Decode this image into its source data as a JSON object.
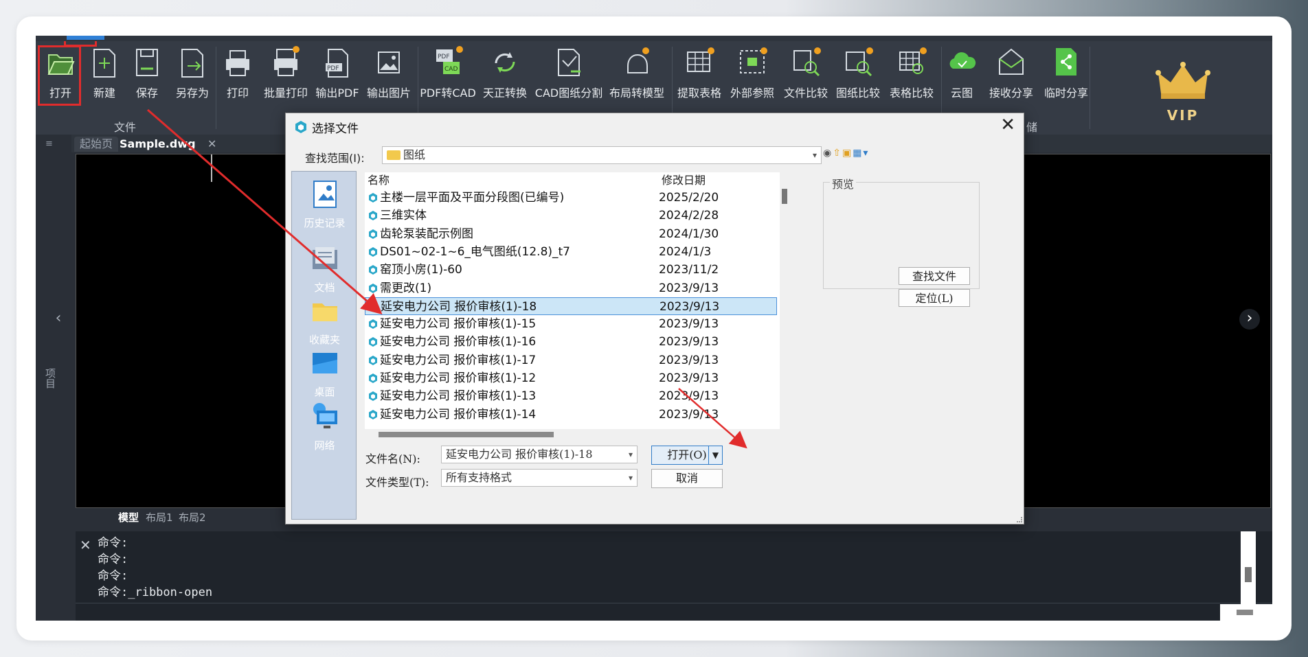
{
  "ribbon": {
    "buttons": [
      {
        "label": "打开"
      },
      {
        "label": "新建"
      },
      {
        "label": "保存"
      },
      {
        "label": "另存为"
      },
      {
        "label": "打印"
      },
      {
        "label": "批量打印"
      },
      {
        "label": "输出PDF"
      },
      {
        "label": "输出图片"
      },
      {
        "label": "PDF转CAD"
      },
      {
        "label": "天正转换"
      },
      {
        "label": "CAD图纸分割"
      },
      {
        "label": "布局转模型"
      },
      {
        "label": "提取表格"
      },
      {
        "label": "外部参照"
      },
      {
        "label": "文件比较"
      },
      {
        "label": "图纸比较"
      },
      {
        "label": "表格比较"
      },
      {
        "label": "云图"
      },
      {
        "label": "接收分享"
      },
      {
        "label": "临时分享"
      }
    ],
    "group_file": "文件",
    "group_partial": "储",
    "vip": "VIP"
  },
  "tabs": {
    "start": "起始页",
    "doc": "Sample.dwg",
    "close": "✕",
    "menu": "≡"
  },
  "left_panel": {
    "label": "项目"
  },
  "layout_tabs": [
    "模型",
    "布局1",
    "布局2"
  ],
  "command": {
    "lines": [
      "命令:",
      "命令:",
      "命令:",
      "命令:_ribbon-open"
    ]
  },
  "dialog": {
    "title": "选择文件",
    "close": "✕",
    "lookin_label": "查找范围(I):",
    "lookin_value": "图纸",
    "places": [
      "历史记录",
      "文档",
      "收藏夹",
      "桌面",
      "网络"
    ],
    "columns": {
      "name": "名称",
      "date": "修改日期"
    },
    "files": [
      {
        "name": "主楼一层平面及平面分段图(已编号)",
        "date": "2025/2/20"
      },
      {
        "name": "三维实体",
        "date": "2024/2/28"
      },
      {
        "name": "齿轮泵装配示例图",
        "date": "2024/1/30"
      },
      {
        "name": "DS01~02-1~6_电气图纸(12.8)_t7",
        "date": "2024/1/3"
      },
      {
        "name": "窑顶小房(1)-60",
        "date": "2023/11/2"
      },
      {
        "name": "需更改(1)",
        "date": "2023/9/13"
      },
      {
        "name": "延安电力公司 报价审核(1)-18",
        "date": "2023/9/13"
      },
      {
        "name": "延安电力公司 报价审核(1)-15",
        "date": "2023/9/13"
      },
      {
        "name": "延安电力公司 报价审核(1)-16",
        "date": "2023/9/13"
      },
      {
        "name": "延安电力公司 报价审核(1)-17",
        "date": "2023/9/13"
      },
      {
        "name": "延安电力公司 报价审核(1)-12",
        "date": "2023/9/13"
      },
      {
        "name": "延安电力公司 报价审核(1)-13",
        "date": "2023/9/13"
      },
      {
        "name": "延安电力公司 报价审核(1)-14",
        "date": "2023/9/13"
      }
    ],
    "preview_label": "预览",
    "find_button": "查找文件(F)...",
    "locate_button": "定位(L)",
    "filename_label": "文件名(N):",
    "filename_value": "延安电力公司 报价审核(1)-18",
    "filetype_label": "文件类型(T):",
    "filetype_value": "所有支持格式",
    "open_button": "打开(O)",
    "cancel_button": "取消"
  },
  "nav": {
    "left": "‹",
    "right": "›"
  },
  "colors": {
    "highlight_red": "#e12c2c",
    "selection": "#cce6f7",
    "accent_blue": "#2f7cc8"
  }
}
